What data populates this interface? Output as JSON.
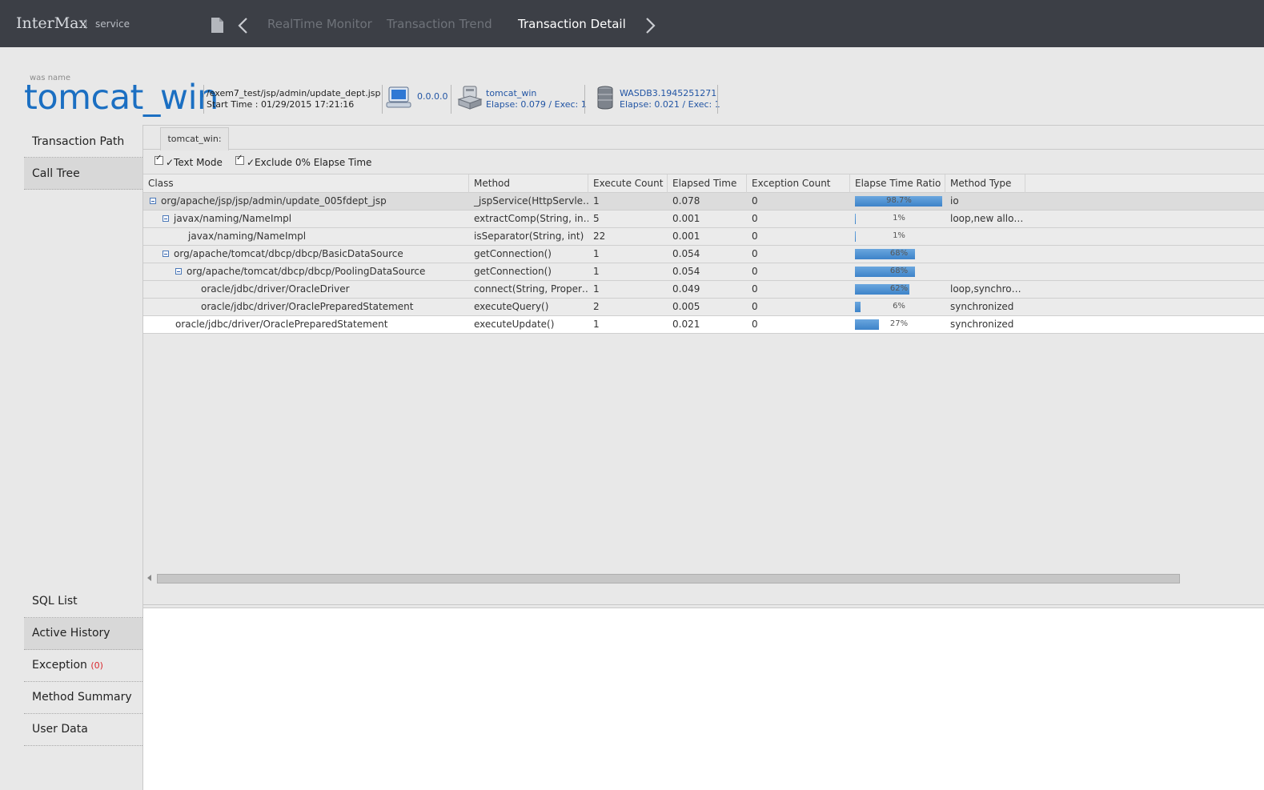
{
  "topbar": {
    "brand": "InterMax",
    "brand_sub": "service",
    "tabs": [
      {
        "label": "RealTime Monitor",
        "active": false
      },
      {
        "label": "Transaction Trend",
        "active": false
      },
      {
        "label": "Transaction Detail",
        "active": true
      }
    ],
    "icons": {
      "document": "document-icon",
      "prev": "chevron-left-icon",
      "next": "chevron-right-icon"
    }
  },
  "header": {
    "was_label": "was name",
    "was_name": "tomcat_win",
    "url": "/exem7_test/jsp/admin/update_dept.jsp",
    "start_time": "Start Time : 01/29/2015 17:21:16",
    "client": {
      "ip": "0.0.0.0",
      "icon": "client-pc-icon"
    },
    "server": {
      "name": "tomcat_win",
      "stats": "Elapse: 0.079 / Exec: 1",
      "icon": "server-icon"
    },
    "database": {
      "name": "WASDB3.1945251271",
      "stats": "Elapse: 0.021 / Exec: 1",
      "icon": "database-icon"
    }
  },
  "sidebar": {
    "top_items": [
      {
        "label": "Transaction Path",
        "selected": false
      },
      {
        "label": "Call Tree",
        "selected": true
      }
    ],
    "bottom_items": [
      {
        "label": "SQL List",
        "selected": false
      },
      {
        "label": "Active History",
        "selected": true
      },
      {
        "label": "Exception",
        "count": "(0)",
        "selected": false
      },
      {
        "label": "Method Summary",
        "selected": false
      },
      {
        "label": "User Data",
        "selected": false
      }
    ]
  },
  "main": {
    "sub_tab": "tomcat_win:",
    "options": {
      "text_mode": "✓Text Mode",
      "exclude_zero": "✓Exclude 0% Elapse Time"
    },
    "columns": [
      "Class",
      "Method",
      "Execute Count",
      "Elapsed Time",
      "Exception Count",
      "Elapse Time Ratio",
      "Method Type"
    ],
    "rows": [
      {
        "class": "org/apache/jsp/jsp/admin/update_005fdept_jsp",
        "indent": 0,
        "toggle": true,
        "method": "_jspService(HttpServle…",
        "exec": "1",
        "elapsed": "0.078",
        "exceptions": "0",
        "ratio": 98.7,
        "ratio_label": "98.7%",
        "type": "io"
      },
      {
        "class": "javax/naming/NameImpl",
        "indent": 1,
        "toggle": true,
        "method": "extractComp(String, in…",
        "exec": "5",
        "elapsed": "0.001",
        "exceptions": "0",
        "ratio": 1,
        "ratio_label": "1%",
        "type": "loop,new allo…"
      },
      {
        "class": "javax/naming/NameImpl",
        "indent": 2,
        "toggle": false,
        "method": "isSeparator(String, int)",
        "exec": "22",
        "elapsed": "0.001",
        "exceptions": "0",
        "ratio": 1,
        "ratio_label": "1%",
        "type": ""
      },
      {
        "class": "org/apache/tomcat/dbcp/dbcp/BasicDataSource",
        "indent": 1,
        "toggle": true,
        "method": "getConnection()",
        "exec": "1",
        "elapsed": "0.054",
        "exceptions": "0",
        "ratio": 68,
        "ratio_label": "68%",
        "type": ""
      },
      {
        "class": "org/apache/tomcat/dbcp/dbcp/PoolingDataSource",
        "indent": 2,
        "toggle": true,
        "method": "getConnection()",
        "exec": "1",
        "elapsed": "0.054",
        "exceptions": "0",
        "ratio": 68,
        "ratio_label": "68%",
        "type": ""
      },
      {
        "class": "oracle/jdbc/driver/OracleDriver",
        "indent": 3,
        "toggle": false,
        "method": "connect(String, Proper…",
        "exec": "1",
        "elapsed": "0.049",
        "exceptions": "0",
        "ratio": 62,
        "ratio_label": "62%",
        "type": "loop,synchro…"
      },
      {
        "class": "oracle/jdbc/driver/OraclePreparedStatement",
        "indent": 3,
        "toggle": false,
        "method": "executeQuery()",
        "exec": "2",
        "elapsed": "0.005",
        "exceptions": "0",
        "ratio": 6,
        "ratio_label": "6%",
        "type": "synchronized"
      },
      {
        "class": "oracle/jdbc/driver/OraclePreparedStatement",
        "indent": 1,
        "toggle": false,
        "method": "executeUpdate()",
        "exec": "1",
        "elapsed": "0.021",
        "exceptions": "0",
        "ratio": 27,
        "ratio_label": "27%",
        "type": "synchronized"
      }
    ],
    "colors": {
      "accent": "#1b6fc2",
      "bar": "#3d83c9",
      "topbar": "#3c3f46",
      "exception": "#d9282e"
    }
  }
}
